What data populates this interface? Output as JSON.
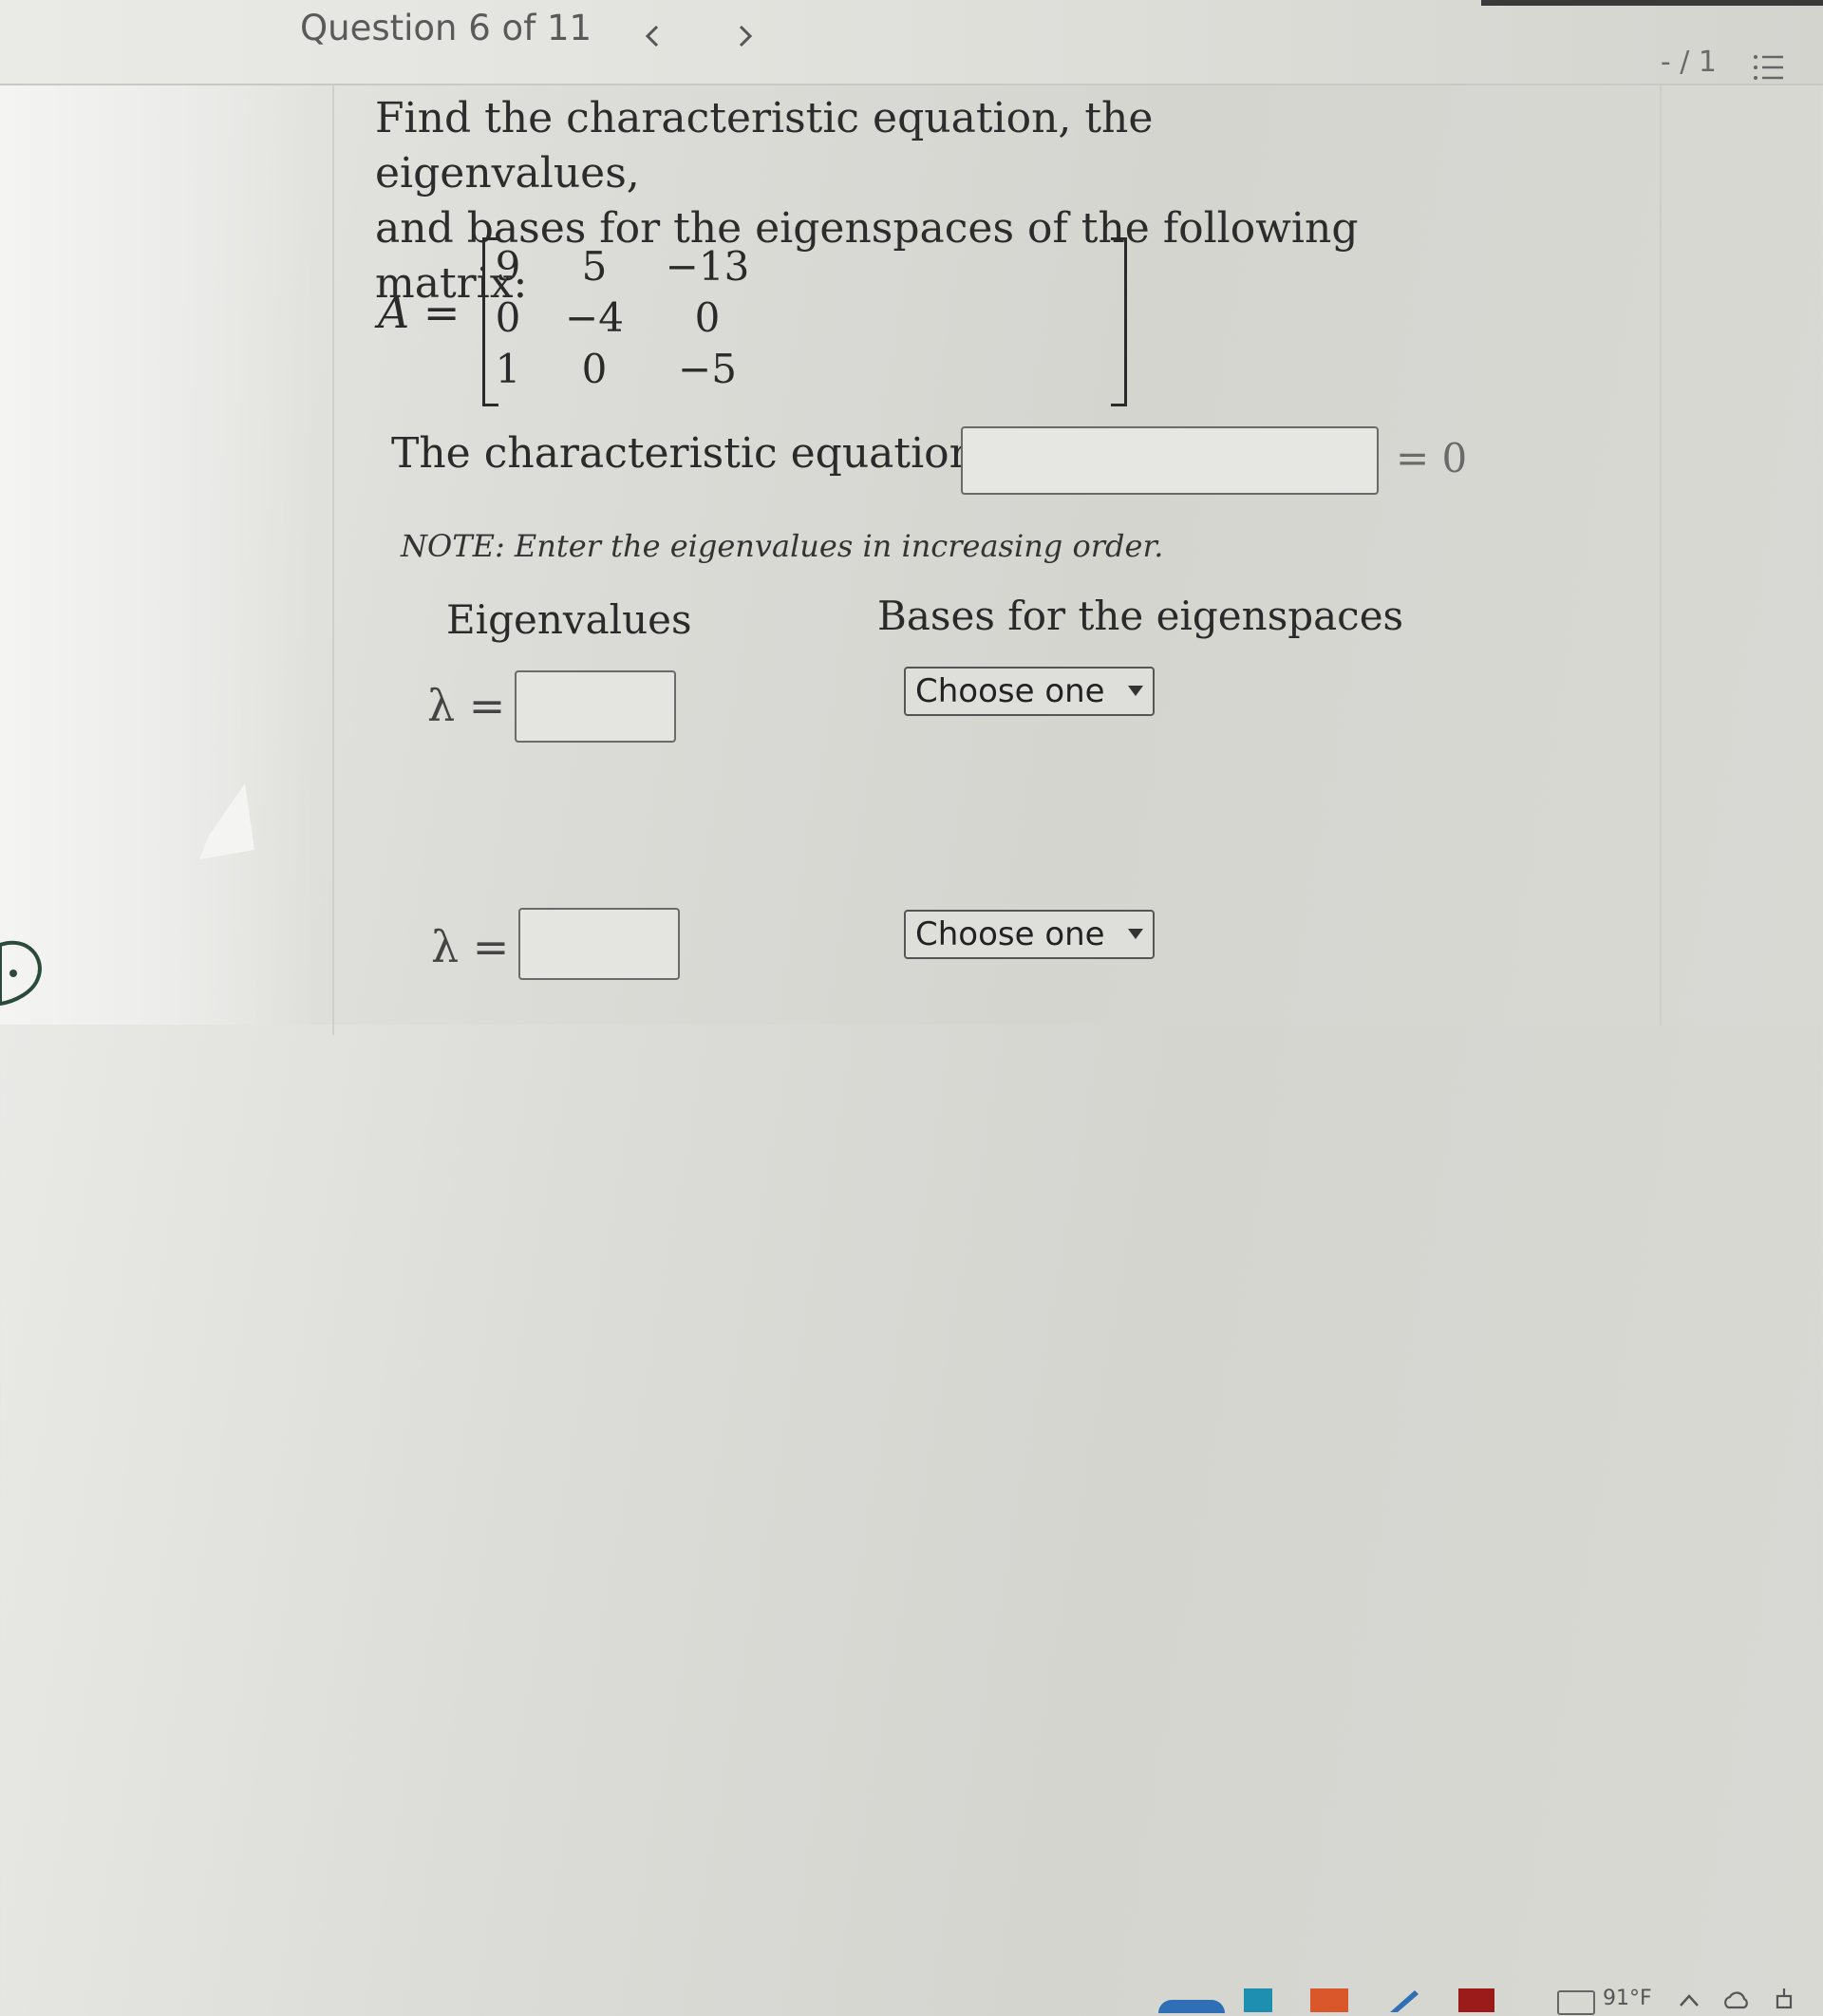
{
  "header": {
    "question_label": "Question 6 of 11",
    "prev_icon": "chevron-left-icon",
    "next_icon": "chevron-right-icon",
    "score": "- / 1",
    "list_icon": "list-icon"
  },
  "problem": {
    "prompt_line1": "Find the characteristic equation, the eigenvalues,",
    "prompt_line2": "and bases for the eigenspaces of the following matrix:",
    "matrix_label": "A",
    "matrix_equals": "=",
    "matrix": [
      [
        "9",
        "5",
        "−13"
      ],
      [
        "0",
        "−4",
        "0"
      ],
      [
        "1",
        "0",
        "−5"
      ]
    ],
    "char_eq_text": "The characteristic equation is",
    "char_eq_value": "",
    "char_eq_suffix": "= 0",
    "note": "NOTE: Enter the eigenvalues in increasing order."
  },
  "table": {
    "eigenvalues_header": "Eigenvalues",
    "bases_header": "Bases for the eigenspaces",
    "rows": [
      {
        "lambda_label": "λ =",
        "value": "",
        "select_label": "Choose one"
      },
      {
        "lambda_label": "λ =",
        "value": "",
        "select_label": "Choose one"
      }
    ]
  },
  "taskbar": {
    "weather": "91°F",
    "weather_icon": "weather-widget-icon",
    "tray_icons": [
      "chevron-up-icon",
      "cloud-icon",
      "network-icon"
    ]
  },
  "colors": {
    "accent_blue": "#2f6fb5",
    "taskbar_orange": "#d9572a",
    "taskbar_red": "#9b1b1b",
    "taskbar_teal": "#1e8fb0"
  }
}
